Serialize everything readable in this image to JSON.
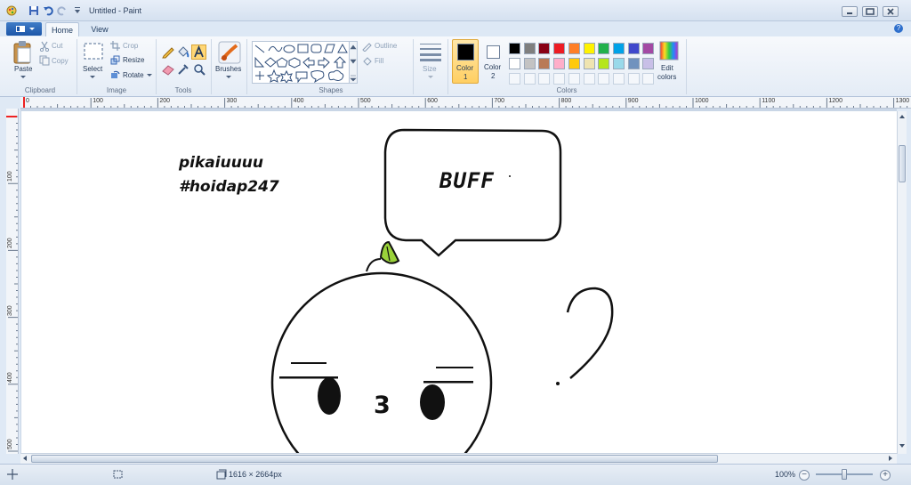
{
  "window": {
    "title": "Untitled - Paint"
  },
  "tabs": {
    "home": "Home",
    "view": "View"
  },
  "ribbon": {
    "clipboard": {
      "label": "Clipboard",
      "paste": "Paste",
      "cut": "Cut",
      "copy": "Copy"
    },
    "image": {
      "label": "Image",
      "select": "Select",
      "crop": "Crop",
      "resize": "Resize",
      "rotate": "Rotate"
    },
    "tools": {
      "label": "Tools"
    },
    "brushes": {
      "label": "Brushes"
    },
    "shapes": {
      "label": "Shapes",
      "outline": "Outline",
      "fill": "Fill"
    },
    "size": {
      "label": "Size"
    },
    "colors": {
      "label": "Colors",
      "color1_label": "Color",
      "color1_num": "1",
      "color2_label": "Color",
      "color2_num": "2",
      "edit_label": "Edit",
      "edit_label2": "colors",
      "color1": "#000000",
      "color2": "#ffffff",
      "palette_row1": [
        "#000000",
        "#7f7f7f",
        "#880015",
        "#ed1c24",
        "#ff7f27",
        "#fff200",
        "#22b14c",
        "#00a2e8",
        "#3f48cc",
        "#a349a4"
      ],
      "palette_row2": [
        "#ffffff",
        "#c3c3c3",
        "#b97a57",
        "#ffaec9",
        "#ffc90e",
        "#efe4b0",
        "#b5e61d",
        "#99d9ea",
        "#7092be",
        "#c8bfe7"
      ]
    }
  },
  "ruler": {
    "top": [
      "0",
      "100",
      "200",
      "300",
      "400",
      "500",
      "600",
      "700",
      "800",
      "900",
      "1000",
      "1100",
      "1200",
      "1300"
    ],
    "left": [
      "100",
      "200",
      "300",
      "400",
      "500"
    ]
  },
  "canvas": {
    "text1": "pikaiuuuu",
    "text2": "#hoidap247",
    "bubble_text": "BUFF",
    "mouth": "3"
  },
  "status": {
    "dimensions": "1616 × 2664px",
    "zoom": "100%"
  }
}
